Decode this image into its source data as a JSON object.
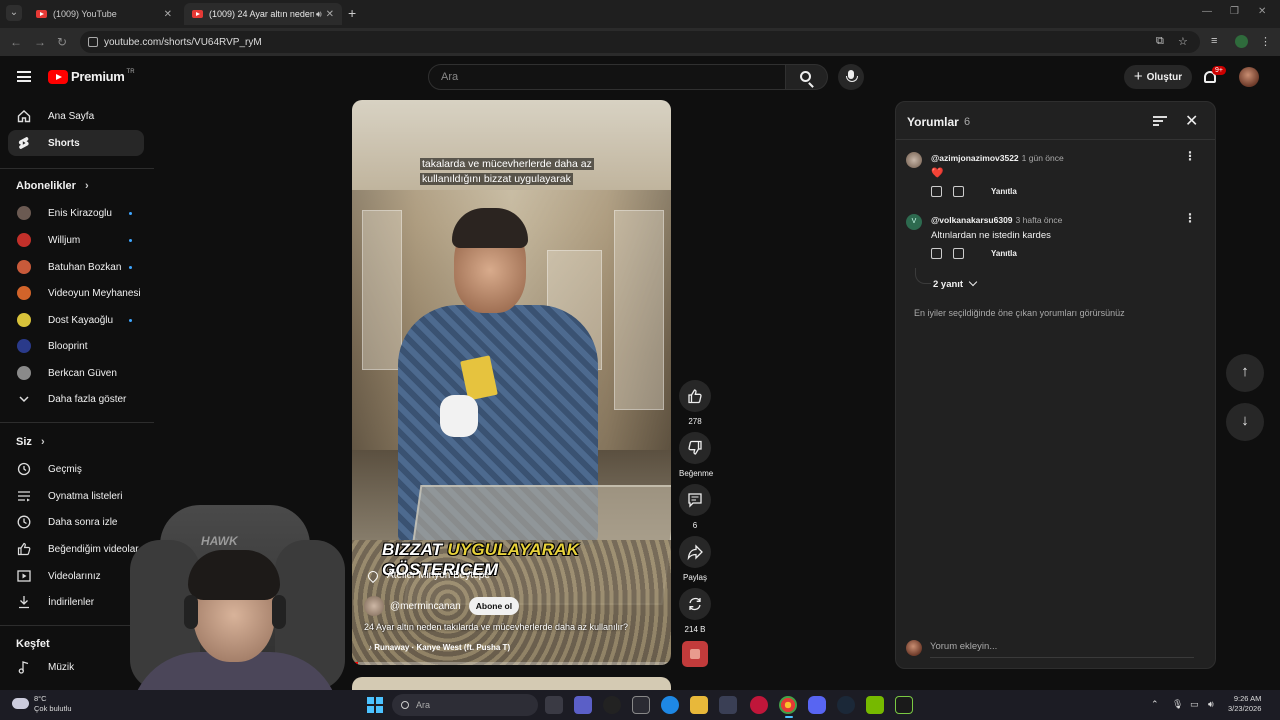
{
  "browser": {
    "tabs": [
      {
        "title": "(1009) YouTube",
        "active": false
      },
      {
        "title": "(1009) 24 Ayar altın neden t",
        "active": true
      }
    ],
    "url": "youtube.com/shorts/VU64RVP_ryM"
  },
  "header": {
    "logo": "Premium",
    "logo_region": "TR",
    "search_placeholder": "Ara",
    "create_label": "Oluştur",
    "notifications_badge": "9+"
  },
  "sidebar": {
    "main": [
      {
        "label": "Ana Sayfa",
        "icon": "home-icon"
      },
      {
        "label": "Shorts",
        "icon": "shorts-icon",
        "active": true
      }
    ],
    "subscriptions_title": "Abonelikler",
    "subscriptions": [
      {
        "label": "Enis Kirazoglu",
        "new": true,
        "color": "#6b5a52"
      },
      {
        "label": "Willjum",
        "new": true,
        "color": "#c2302a"
      },
      {
        "label": "Batuhan Bozkan",
        "new": true,
        "color": "#c85a3a"
      },
      {
        "label": "Videoyun Meyhanesi",
        "new": false,
        "color": "#d2642a"
      },
      {
        "label": "Dost Kayaoğlu",
        "new": true,
        "color": "#d8c23a"
      },
      {
        "label": "Blooprint",
        "new": false,
        "color": "#2a3a8a"
      },
      {
        "label": "Berkcan Güven",
        "new": false,
        "color": "#8a8a8a"
      }
    ],
    "show_more": "Daha fazla göster",
    "you_title": "Siz",
    "you_items": [
      {
        "label": "Geçmiş",
        "icon": "history-icon"
      },
      {
        "label": "Oynatma listeleri",
        "icon": "playlists-icon"
      },
      {
        "label": "Daha sonra izle",
        "icon": "watch-later-icon"
      },
      {
        "label": "Beğendiğim videolar",
        "icon": "liked-videos-icon"
      },
      {
        "label": "Videolarınız",
        "icon": "your-videos-icon"
      },
      {
        "label": "İndirilenler",
        "icon": "downloads-icon"
      }
    ],
    "explore_title": "Keşfet",
    "explore_items": [
      {
        "label": "Müzik",
        "icon": "music-icon"
      }
    ]
  },
  "short": {
    "overlay_caption": "takalarda ve mücevherlerde daha az kullanıldığını bizzat uygulayarak",
    "big_text_1": "BIZZAT",
    "big_text_2": "UYGULAYARAK",
    "big_text_3": "GÖSTERICEM",
    "location": "Atelier Minyon Beytepe",
    "channel": "@mermincanan",
    "subscribe": "Abone ol",
    "title": "24 Ayar altın neden takılarda ve mücevherlerde daha az kullanılır?",
    "music": "Runaway · Kanye West (ft. Pusha T)",
    "progress": 0.02
  },
  "actions": {
    "like_count": "278",
    "dislike_label": "Beğenme",
    "comment_count": "6",
    "share_label": "Paylaş",
    "remix_count": "214 B"
  },
  "comments": {
    "title": "Yorumlar",
    "count": "6",
    "items": [
      {
        "user": "@azimjonazimov3522",
        "time": "1 gün önce",
        "text": "❤️",
        "reply": "Yanıtla"
      },
      {
        "user": "@volkanakarsu6309",
        "time": "3 hafta önce",
        "text": "Altınlardan ne istedin  kardes",
        "reply": "Yanıtla",
        "avatar_letter": "V"
      }
    ],
    "replies": "2 yanıt",
    "note": "En iyiler seçildiğinde öne çıkan yorumları görürsünüz",
    "input_placeholder": "Yorum ekleyin..."
  },
  "webcam": {
    "chair_brand": "HAWK"
  },
  "taskbar": {
    "weather_temp": "8°C",
    "weather_desc": "Çok bulutlu",
    "search_placeholder": "Ara",
    "time": "9:26 AM",
    "date": "3/23/2026"
  }
}
